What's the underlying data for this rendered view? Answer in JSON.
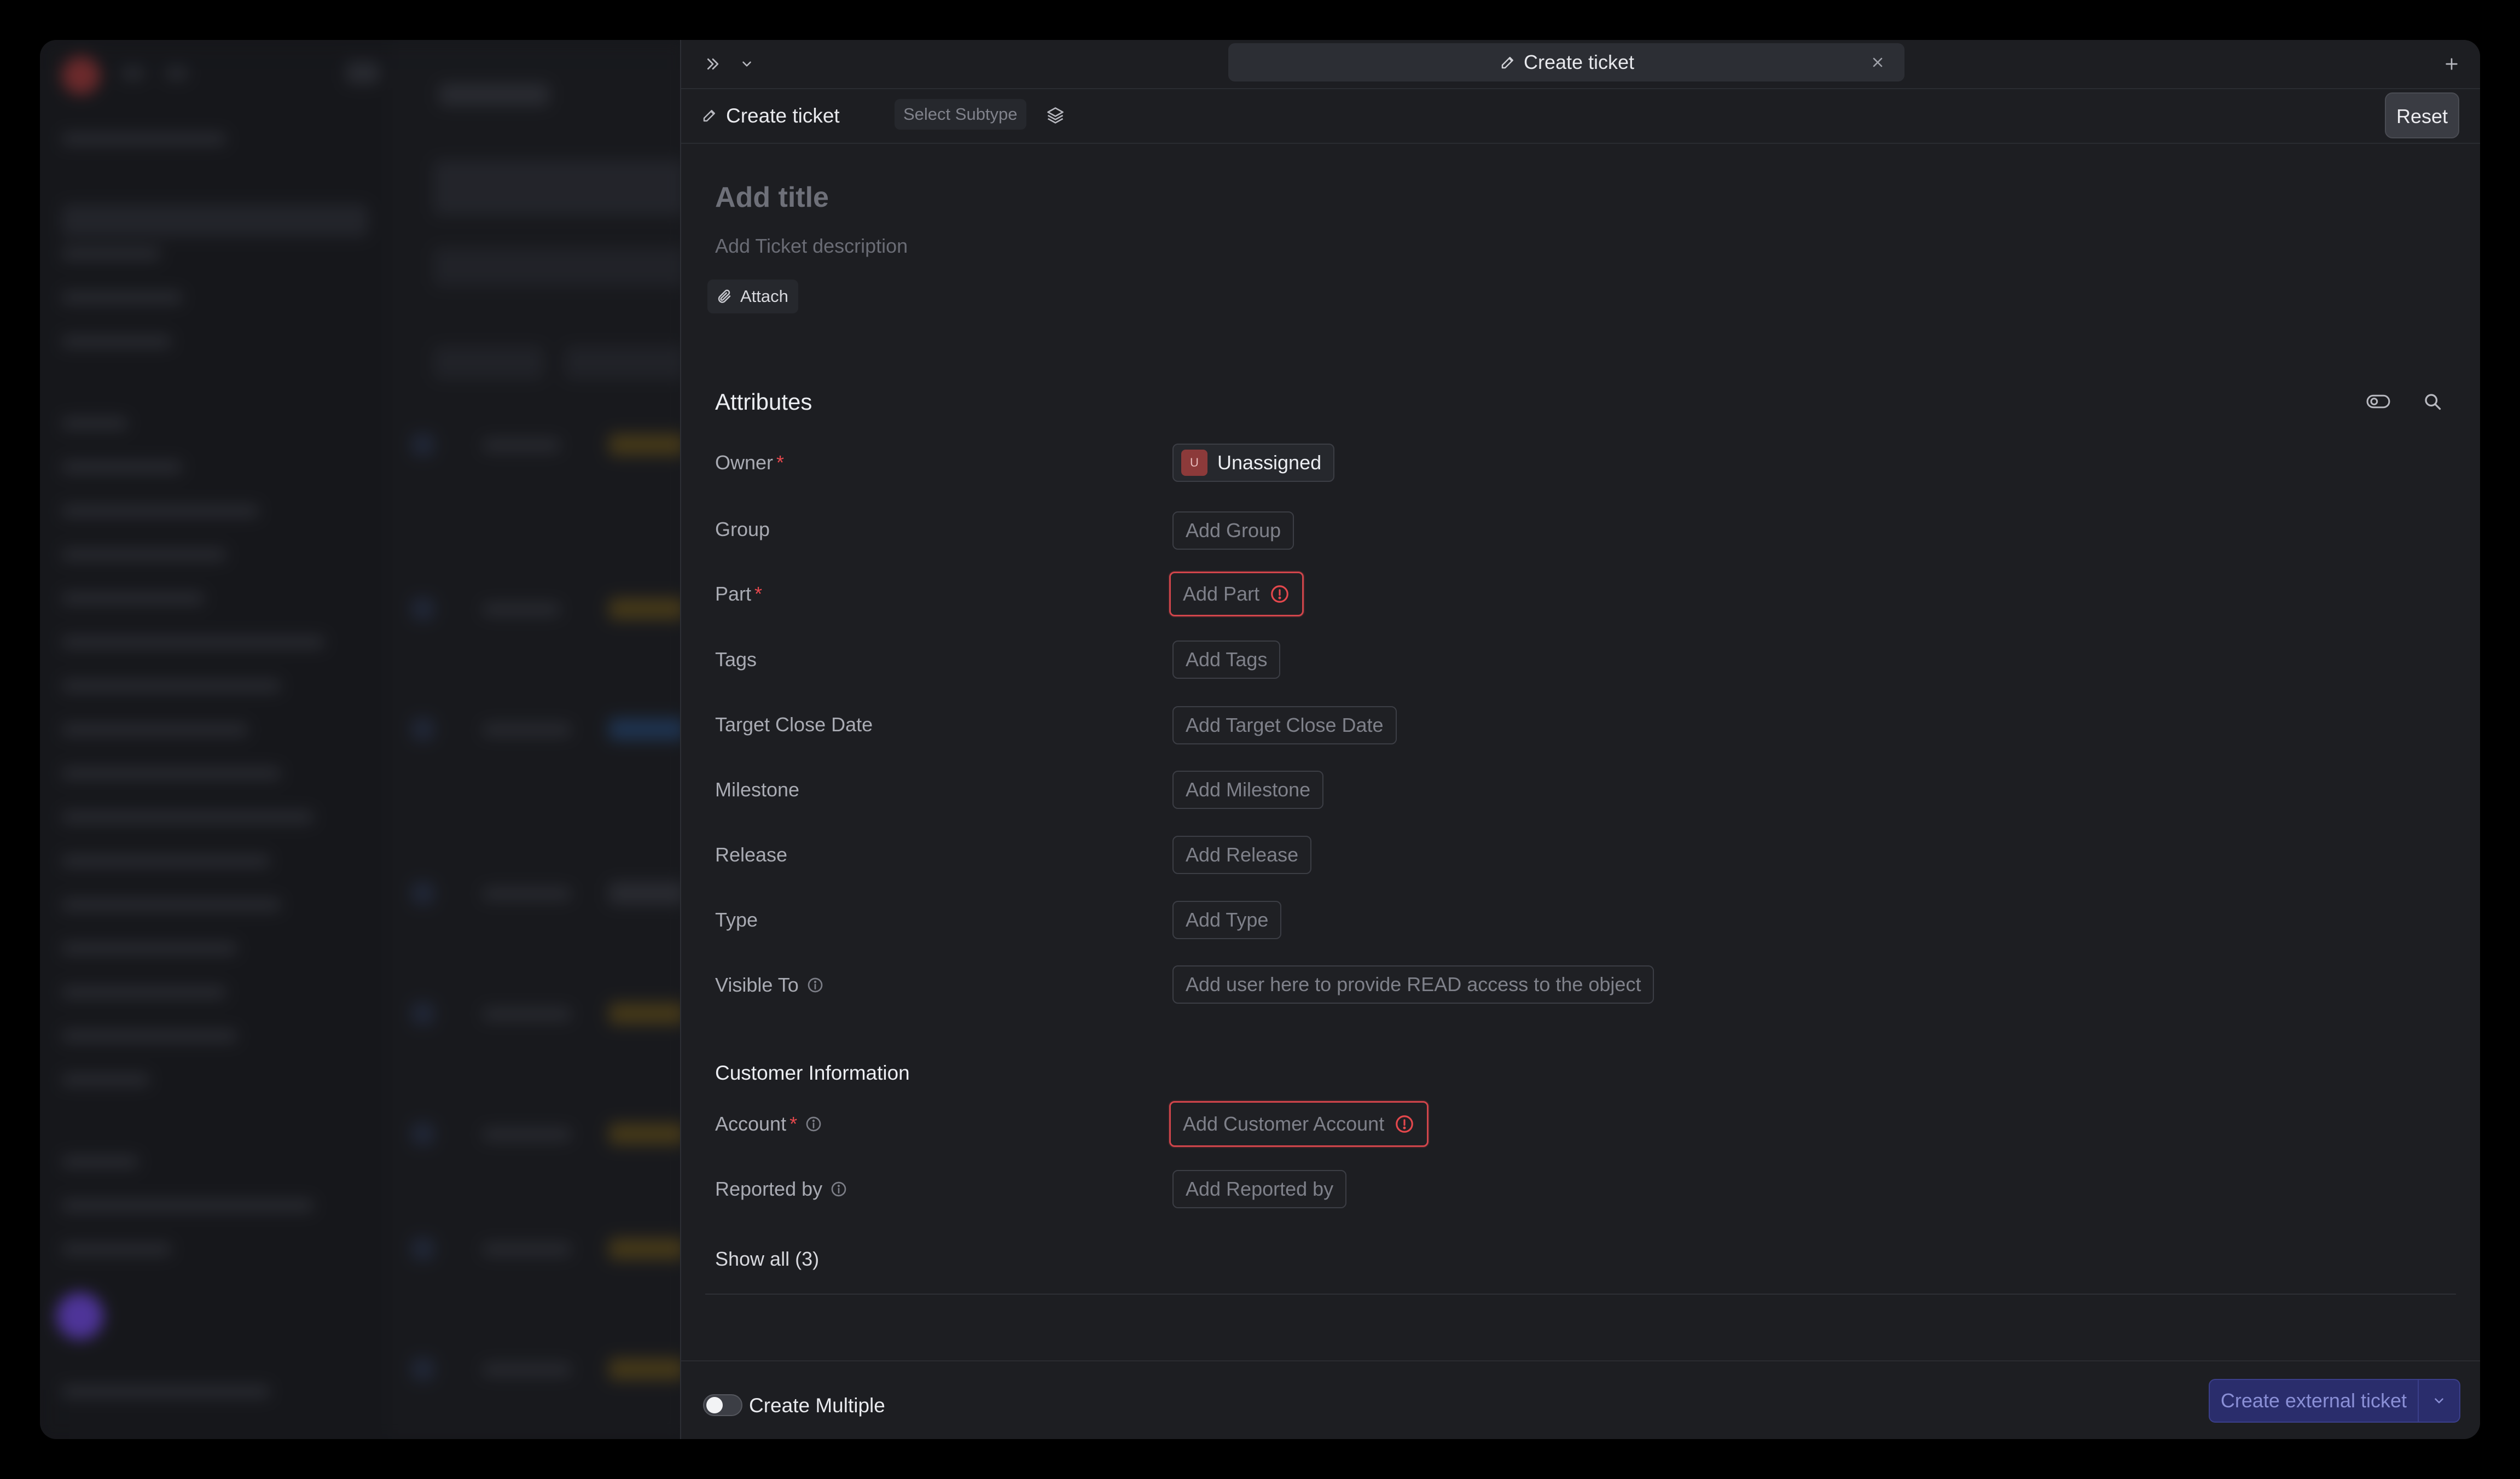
{
  "tab": {
    "title": "Create ticket"
  },
  "header": {
    "title": "Create ticket",
    "subtype_placeholder": "Select Subtype",
    "reset_label": "Reset"
  },
  "ticket": {
    "title_placeholder": "Add title",
    "description_placeholder": "Add Ticket description",
    "attach_label": "Attach"
  },
  "attributes": {
    "title": "Attributes",
    "fields": [
      {
        "label": "Owner",
        "required": true,
        "value": "Unassigned",
        "avatar_initial": "U"
      },
      {
        "label": "Group",
        "placeholder": "Add Group"
      },
      {
        "label": "Part",
        "required": true,
        "placeholder": "Add Part",
        "error": true
      },
      {
        "label": "Tags",
        "placeholder": "Add Tags"
      },
      {
        "label": "Target Close Date",
        "placeholder": "Add Target Close Date"
      },
      {
        "label": "Milestone",
        "placeholder": "Add Milestone"
      },
      {
        "label": "Release",
        "placeholder": "Add Release"
      },
      {
        "label": "Type",
        "placeholder": "Add Type"
      },
      {
        "label": "Visible To",
        "info": true,
        "placeholder": "Add user here to provide READ access to the object"
      }
    ]
  },
  "customer": {
    "title": "Customer Information",
    "fields": [
      {
        "label": "Account",
        "required": true,
        "info": true,
        "placeholder": "Add Customer Account",
        "error": true
      },
      {
        "label": "Reported by",
        "info": true,
        "placeholder": "Add Reported by"
      }
    ],
    "show_all_label": "Show all (3)"
  },
  "footer": {
    "create_multiple_label": "Create Multiple",
    "create_multiple_on": false,
    "create_button_label": "Create external ticket"
  },
  "colors": {
    "accent": "#2a2d6c",
    "error": "#e5484d",
    "panel_bg": "#1d1e22"
  },
  "icons": [
    "expand-icon",
    "chevron-down-icon",
    "edit-icon",
    "close-icon",
    "plus-icon",
    "layers-icon",
    "paperclip-icon",
    "toggle-icon",
    "search-icon",
    "info-icon",
    "alert-icon"
  ]
}
